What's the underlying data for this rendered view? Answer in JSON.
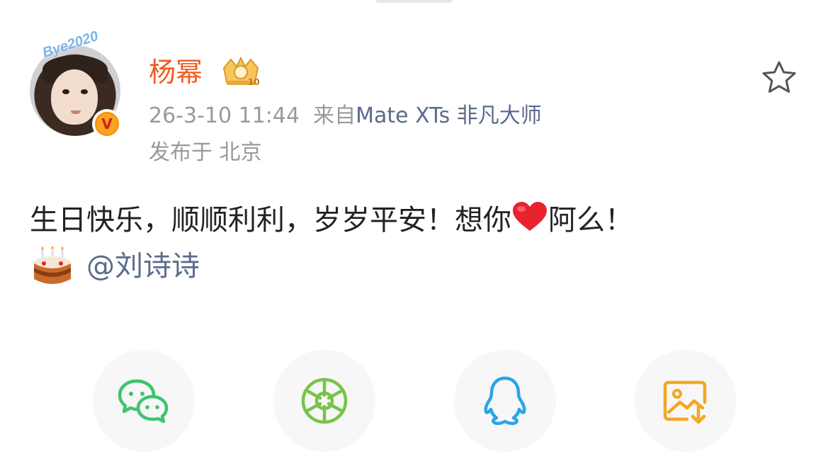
{
  "post": {
    "author": {
      "name": "杨幂",
      "avatar_sticker_text": "Bye2020",
      "verified_badge": "V",
      "vip_level": "10"
    },
    "meta": {
      "timestamp": "26-3-10 11:44",
      "source_prefix": "来自",
      "source": "Mate XTs 非凡大师",
      "location": "发布于 北京"
    },
    "text_part1": "生日快乐，顺顺利利，岁岁平安！想你",
    "text_part2": "阿么！",
    "mention": "@刘诗诗"
  },
  "colors": {
    "username": "#f05a1e",
    "meta": "#999999",
    "link": "#5b6b8c",
    "wechat": "#3fc46b",
    "moments": "#78c34a",
    "qq": "#2aa5e8",
    "save": "#f5a623"
  },
  "share_targets": [
    {
      "icon": "wechat-icon"
    },
    {
      "icon": "moments-icon"
    },
    {
      "icon": "qq-icon"
    },
    {
      "icon": "save-image-icon"
    }
  ]
}
